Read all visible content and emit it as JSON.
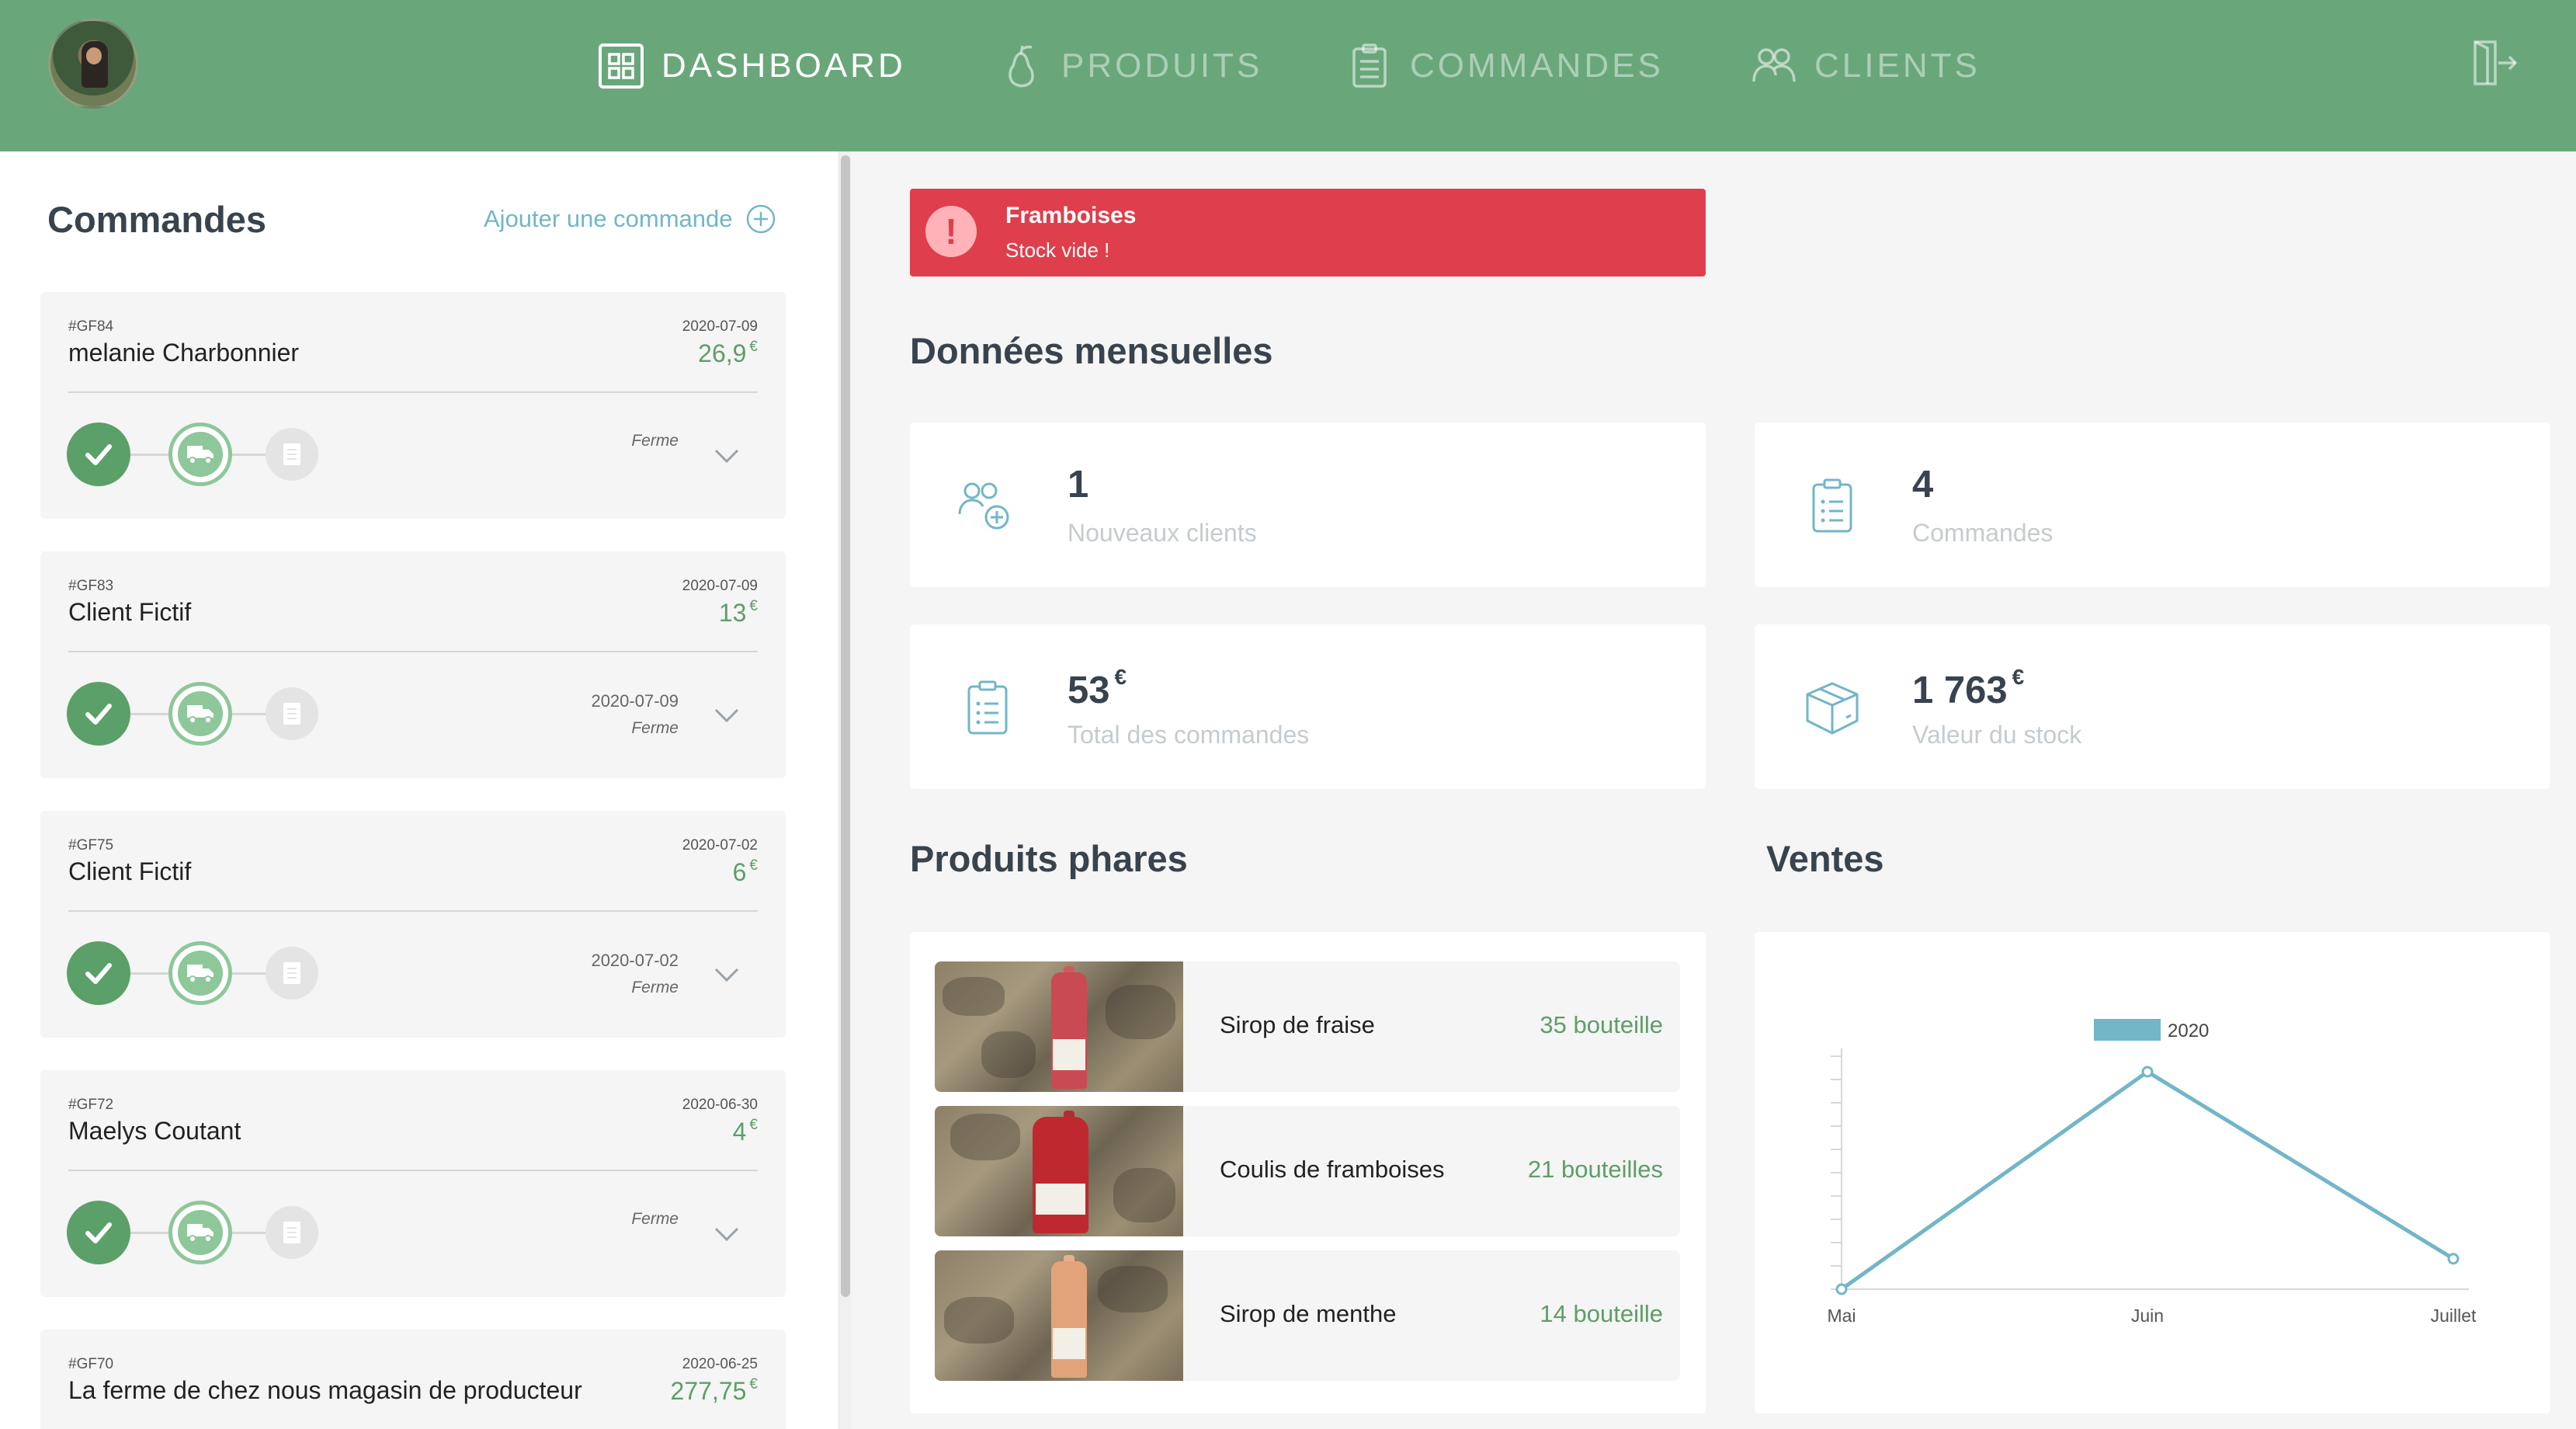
{
  "nav": {
    "dashboard": "DASHBOARD",
    "produits": "PRODUITS",
    "commandes": "COMMANDES",
    "clients": "CLIENTS"
  },
  "orders_panel": {
    "title": "Commandes",
    "add_label": "Ajouter une commande",
    "orders": [
      {
        "code": "#GF84",
        "date": "2020-07-09",
        "client": "melanie Charbonnier",
        "amount": "26,9",
        "currency": "€",
        "delivery_date": "",
        "status": "Ferme"
      },
      {
        "code": "#GF83",
        "date": "2020-07-09",
        "client": "Client Fictif",
        "amount": "13",
        "currency": "€",
        "delivery_date": "2020-07-09",
        "status": "Ferme"
      },
      {
        "code": "#GF75",
        "date": "2020-07-02",
        "client": "Client Fictif",
        "amount": "6",
        "currency": "€",
        "delivery_date": "2020-07-02",
        "status": "Ferme"
      },
      {
        "code": "#GF72",
        "date": "2020-06-30",
        "client": "Maelys Coutant",
        "amount": "4",
        "currency": "€",
        "delivery_date": "",
        "status": "Ferme"
      },
      {
        "code": "#GF70",
        "date": "2020-06-25",
        "client": "La ferme de chez nous magasin de producteur",
        "amount": "277,75",
        "currency": "€",
        "delivery_date": "",
        "status": ""
      }
    ]
  },
  "alert": {
    "title": "Framboises",
    "message": "Stock vide !",
    "icon": "!"
  },
  "monthly": {
    "title": "Données mensuelles",
    "new_clients": {
      "value": "1",
      "label": "Nouveaux clients"
    },
    "orders": {
      "value": "4",
      "label": "Commandes"
    },
    "total": {
      "value": "53",
      "currency": "€",
      "label": "Total des commandes"
    },
    "stock": {
      "value": "1 763",
      "currency": "€",
      "label": "Valeur du stock"
    }
  },
  "products": {
    "title": "Produits phares",
    "items": [
      {
        "name": "Sirop de fraise",
        "qty": "35 bouteille"
      },
      {
        "name": "Coulis de framboises",
        "qty": "21 bouteilles"
      },
      {
        "name": "Sirop de menthe",
        "qty": "14 bouteille"
      }
    ]
  },
  "sales": {
    "title": "Ventes"
  },
  "colors": {
    "brand": "#69a77b",
    "alert": "#df3e4c",
    "accent": "#72b6c8",
    "money": "#5f9d6a"
  },
  "chart_data": {
    "type": "line",
    "categories": [
      "Mai",
      "Juin",
      "Juillet"
    ],
    "series": [
      {
        "name": "2020",
        "values": [
          0,
          100,
          14
        ],
        "color": "#72b6c8"
      }
    ],
    "ylim": [
      0,
      100
    ],
    "legend": "top"
  }
}
